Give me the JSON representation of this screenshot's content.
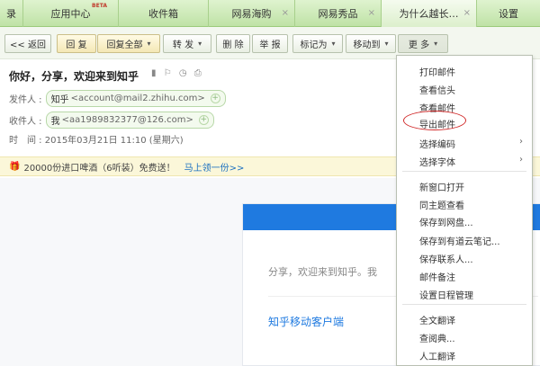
{
  "tabs": [
    {
      "label": "录"
    },
    {
      "label": "应用中心",
      "badge": "BETA"
    },
    {
      "label": "收件箱"
    },
    {
      "label": "网易海购",
      "closable": true
    },
    {
      "label": "网易秀品",
      "closable": true
    },
    {
      "label": "为什么越长…",
      "closable": true
    },
    {
      "label": "设置"
    }
  ],
  "close_glyph": "×",
  "toolbar": {
    "back": "<< 返回",
    "reply": "回 复",
    "reply_all": "回复全部",
    "forward": "转 发",
    "delete": "删 除",
    "report": "举 报",
    "mark_as": "标记为",
    "move_to": "移动到",
    "more": "更 多"
  },
  "mail": {
    "subject": "你好，分享，欢迎来到知乎",
    "from_label": "发件人 :",
    "from_name": "知乎",
    "from_addr": "<account@mail2.zhihu.com>",
    "to_label": "收件人 :",
    "to_name": "我",
    "to_addr": "<aa1989832377@126.com>",
    "time": "时　间 : 2015年03月21日 11:10 (星期六)"
  },
  "ad": {
    "text": "20000份进口啤酒（6听装）免费送！",
    "link": "马上领一份>>"
  },
  "card": {
    "text": "分享，欢迎来到知乎。我",
    "link": "知乎移动客户端"
  },
  "menu": {
    "items": [
      "打印邮件",
      "查看信头",
      "查看邮件",
      "导出邮件",
      "选择编码",
      "选择字体",
      "新窗口打开",
      "同主题查看",
      "保存到网盘...",
      "保存到有道云笔记...",
      "保存联系人...",
      "邮件备注",
      "设置日程管理",
      "全文翻译",
      "查阅典...",
      "人工翻译"
    ]
  },
  "colors": {
    "accent": "#1f7ae0",
    "highlight_circle": "#d12b2b"
  }
}
